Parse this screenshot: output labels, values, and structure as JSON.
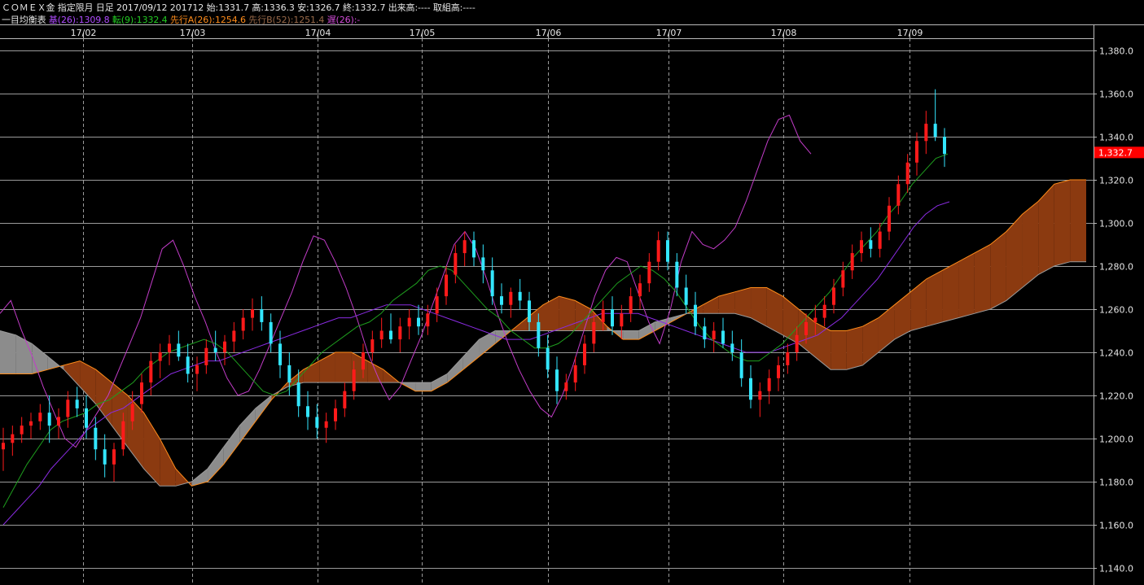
{
  "header": {
    "line1": "ＣＯＭＥＸ金 指定限月 日足 2017/09/12 201712 始:1331.7 高:1336.3 安:1326.7 終:1332.7 出来高:---- 取組高:----",
    "indicator_name": "一目均衡表",
    "base_label": "基(26):1309.8",
    "conv_label": "転(9):1332.4",
    "spanA_label": "先行A(26):1254.6",
    "spanB_label": "先行B(52):1251.4",
    "lag_label": "遅(26):-"
  },
  "colors": {
    "background": "#000000",
    "grid": "#8a8a8a",
    "up_candle": "#ff1a1a",
    "down_candle": "#33e6ff",
    "base_line": "#8a2be2",
    "conversion_line": "#1e9e1e",
    "span_a": "#ff8c1a",
    "span_b": "#9a9a9a",
    "lagging_span": "#c23cc8",
    "cloud_bull": "#8b3a10",
    "cloud_bear": "#8c8c8c",
    "last_price_bg": "#ff0000",
    "base_label_color": "#b04cff",
    "conv_label_color": "#22cc22",
    "spanA_label_color": "#ff8c1a",
    "spanB_label_color": "#9a6a4a",
    "lag_label_color": "#d24cd8"
  },
  "chart_data": {
    "type": "candlestick",
    "x_ticks": [
      "17/02",
      "17/03",
      "17/04",
      "17/05",
      "17/06",
      "17/07",
      "17/08",
      "17/09"
    ],
    "y_ticks": [
      "1,380.0",
      "1,360.0",
      "1,340.0",
      "1,320.0",
      "1,300.0",
      "1,280.0",
      "1,260.0",
      "1,240.0",
      "1,220.0",
      "1,200.0",
      "1,180.0",
      "1,160.0",
      "1,140.0"
    ],
    "ylim": [
      1140,
      1380
    ],
    "last_price": 1332.7,
    "last_price_label": "1,332.7",
    "grid": true,
    "candles": [
      [
        1195,
        1205,
        1185,
        1198
      ],
      [
        1198,
        1206,
        1192,
        1202
      ],
      [
        1202,
        1210,
        1198,
        1206
      ],
      [
        1206,
        1212,
        1200,
        1208
      ],
      [
        1208,
        1216,
        1204,
        1212
      ],
      [
        1212,
        1220,
        1198,
        1206
      ],
      [
        1206,
        1214,
        1200,
        1210
      ],
      [
        1210,
        1222,
        1205,
        1218
      ],
      [
        1218,
        1224,
        1210,
        1214
      ],
      [
        1214,
        1220,
        1200,
        1205
      ],
      [
        1205,
        1210,
        1190,
        1195
      ],
      [
        1195,
        1202,
        1182,
        1188
      ],
      [
        1188,
        1198,
        1180,
        1195
      ],
      [
        1195,
        1212,
        1192,
        1208
      ],
      [
        1208,
        1222,
        1204,
        1216
      ],
      [
        1216,
        1230,
        1212,
        1226
      ],
      [
        1226,
        1240,
        1220,
        1236
      ],
      [
        1236,
        1244,
        1228,
        1240
      ],
      [
        1240,
        1248,
        1234,
        1244
      ],
      [
        1244,
        1250,
        1236,
        1238
      ],
      [
        1238,
        1244,
        1226,
        1230
      ],
      [
        1230,
        1238,
        1222,
        1234
      ],
      [
        1234,
        1246,
        1230,
        1242
      ],
      [
        1242,
        1250,
        1236,
        1240
      ],
      [
        1240,
        1248,
        1234,
        1245
      ],
      [
        1245,
        1254,
        1240,
        1250
      ],
      [
        1250,
        1260,
        1246,
        1256
      ],
      [
        1256,
        1265,
        1250,
        1260
      ],
      [
        1260,
        1266,
        1250,
        1254
      ],
      [
        1254,
        1258,
        1240,
        1244
      ],
      [
        1244,
        1250,
        1228,
        1234
      ],
      [
        1234,
        1240,
        1220,
        1226
      ],
      [
        1226,
        1232,
        1210,
        1215
      ],
      [
        1215,
        1222,
        1204,
        1210
      ],
      [
        1210,
        1216,
        1200,
        1205
      ],
      [
        1205,
        1212,
        1198,
        1208
      ],
      [
        1208,
        1218,
        1204,
        1214
      ],
      [
        1214,
        1226,
        1210,
        1222
      ],
      [
        1222,
        1236,
        1218,
        1232
      ],
      [
        1232,
        1244,
        1228,
        1240
      ],
      [
        1240,
        1250,
        1236,
        1246
      ],
      [
        1246,
        1256,
        1242,
        1250
      ],
      [
        1250,
        1258,
        1244,
        1246
      ],
      [
        1246,
        1256,
        1240,
        1252
      ],
      [
        1252,
        1260,
        1246,
        1256
      ],
      [
        1256,
        1262,
        1248,
        1252
      ],
      [
        1252,
        1262,
        1248,
        1258
      ],
      [
        1258,
        1270,
        1254,
        1266
      ],
      [
        1266,
        1280,
        1262,
        1276
      ],
      [
        1276,
        1290,
        1272,
        1286
      ],
      [
        1286,
        1296,
        1280,
        1292
      ],
      [
        1292,
        1296,
        1280,
        1284
      ],
      [
        1284,
        1290,
        1272,
        1278
      ],
      [
        1278,
        1284,
        1262,
        1266
      ],
      [
        1266,
        1272,
        1258,
        1262
      ],
      [
        1262,
        1270,
        1256,
        1268
      ],
      [
        1268,
        1274,
        1260,
        1264
      ],
      [
        1264,
        1268,
        1250,
        1254
      ],
      [
        1254,
        1258,
        1238,
        1242
      ],
      [
        1242,
        1248,
        1228,
        1232
      ],
      [
        1232,
        1238,
        1216,
        1222
      ],
      [
        1222,
        1230,
        1218,
        1226
      ],
      [
        1226,
        1238,
        1222,
        1234
      ],
      [
        1234,
        1248,
        1230,
        1244
      ],
      [
        1244,
        1258,
        1240,
        1254
      ],
      [
        1254,
        1264,
        1250,
        1260
      ],
      [
        1260,
        1266,
        1248,
        1252
      ],
      [
        1252,
        1262,
        1246,
        1258
      ],
      [
        1258,
        1270,
        1254,
        1266
      ],
      [
        1266,
        1276,
        1260,
        1272
      ],
      [
        1272,
        1286,
        1268,
        1282
      ],
      [
        1282,
        1296,
        1278,
        1292
      ],
      [
        1292,
        1296,
        1278,
        1282
      ],
      [
        1282,
        1286,
        1266,
        1270
      ],
      [
        1270,
        1276,
        1258,
        1262
      ],
      [
        1262,
        1268,
        1248,
        1252
      ],
      [
        1252,
        1256,
        1242,
        1246
      ],
      [
        1246,
        1254,
        1240,
        1250
      ],
      [
        1250,
        1256,
        1242,
        1244
      ],
      [
        1244,
        1250,
        1236,
        1240
      ],
      [
        1240,
        1246,
        1224,
        1228
      ],
      [
        1228,
        1234,
        1214,
        1218
      ],
      [
        1218,
        1226,
        1210,
        1222
      ],
      [
        1222,
        1232,
        1216,
        1228
      ],
      [
        1228,
        1238,
        1222,
        1234
      ],
      [
        1234,
        1244,
        1230,
        1240
      ],
      [
        1240,
        1252,
        1236,
        1248
      ],
      [
        1248,
        1258,
        1244,
        1254
      ],
      [
        1254,
        1262,
        1248,
        1256
      ],
      [
        1256,
        1266,
        1252,
        1262
      ],
      [
        1262,
        1274,
        1258,
        1270
      ],
      [
        1270,
        1282,
        1266,
        1278
      ],
      [
        1278,
        1290,
        1274,
        1286
      ],
      [
        1286,
        1296,
        1282,
        1292
      ],
      [
        1292,
        1298,
        1284,
        1288
      ],
      [
        1288,
        1300,
        1284,
        1296
      ],
      [
        1296,
        1312,
        1292,
        1308
      ],
      [
        1308,
        1322,
        1304,
        1318
      ],
      [
        1318,
        1332,
        1314,
        1328
      ],
      [
        1328,
        1342,
        1322,
        1338
      ],
      [
        1338,
        1352,
        1332,
        1346
      ],
      [
        1346,
        1362,
        1338,
        1340
      ],
      [
        1340,
        1344,
        1326,
        1332
      ]
    ],
    "conversion_line": [
      1168,
      1178,
      1188,
      1196,
      1204,
      1208,
      1210,
      1212,
      1216,
      1218,
      1222,
      1226,
      1232,
      1236,
      1240,
      1242,
      1244,
      1246,
      1244,
      1240,
      1234,
      1228,
      1222,
      1220,
      1222,
      1228,
      1234,
      1240,
      1244,
      1248,
      1252,
      1254,
      1258,
      1264,
      1268,
      1272,
      1278,
      1280,
      1278,
      1272,
      1266,
      1260,
      1256,
      1250,
      1246,
      1242,
      1242,
      1244,
      1248,
      1254,
      1260,
      1266,
      1272,
      1276,
      1280,
      1278,
      1274,
      1268,
      1260,
      1252,
      1246,
      1242,
      1238,
      1236,
      1236,
      1240,
      1244,
      1250,
      1256,
      1262,
      1268,
      1276,
      1284,
      1290,
      1296,
      1304,
      1310,
      1318,
      1324,
      1330,
      1332
    ],
    "base_line": [
      1160,
      1166,
      1172,
      1178,
      1186,
      1192,
      1198,
      1204,
      1208,
      1212,
      1214,
      1218,
      1222,
      1226,
      1230,
      1232,
      1234,
      1236,
      1236,
      1238,
      1240,
      1242,
      1244,
      1246,
      1248,
      1250,
      1252,
      1254,
      1256,
      1256,
      1258,
      1260,
      1262,
      1262,
      1262,
      1260,
      1258,
      1256,
      1254,
      1252,
      1250,
      1248,
      1246,
      1246,
      1246,
      1248,
      1250,
      1252,
      1254,
      1256,
      1258,
      1258,
      1258,
      1258,
      1256,
      1254,
      1252,
      1250,
      1248,
      1246,
      1244,
      1242,
      1240,
      1240,
      1240,
      1242,
      1244,
      1246,
      1248,
      1252,
      1256,
      1262,
      1268,
      1274,
      1282,
      1290,
      1298,
      1304,
      1308,
      1309.8
    ],
    "lagging_span": [
      1258,
      1264,
      1250,
      1238,
      1224,
      1212,
      1200,
      1196,
      1204,
      1212,
      1220,
      1232,
      1244,
      1256,
      1272,
      1288,
      1292,
      1280,
      1266,
      1254,
      1240,
      1228,
      1220,
      1222,
      1232,
      1244,
      1256,
      1268,
      1282,
      1294,
      1292,
      1282,
      1270,
      1256,
      1240,
      1228,
      1218,
      1224,
      1236,
      1248,
      1262,
      1276,
      1290,
      1296,
      1288,
      1274,
      1258,
      1244,
      1232,
      1222,
      1214,
      1210,
      1220,
      1234,
      1250,
      1266,
      1278,
      1284,
      1282,
      1268,
      1254,
      1244,
      1260,
      1282,
      1296,
      1290,
      1288,
      1292,
      1298,
      1310,
      1324,
      1338,
      1348,
      1350,
      1338,
      1332
    ],
    "span_a": [
      1230,
      1230,
      1230,
      1232,
      1234,
      1236,
      1232,
      1226,
      1220,
      1212,
      1200,
      1186,
      1178,
      1180,
      1188,
      1198,
      1208,
      1218,
      1226,
      1232,
      1236,
      1240,
      1240,
      1236,
      1232,
      1226,
      1222,
      1222,
      1226,
      1232,
      1238,
      1244,
      1250,
      1256,
      1262,
      1266,
      1264,
      1260,
      1252,
      1246,
      1246,
      1250,
      1254,
      1258,
      1262,
      1266,
      1268,
      1270,
      1270,
      1266,
      1260,
      1254,
      1250,
      1250,
      1252,
      1256,
      1262,
      1268,
      1274,
      1278,
      1282,
      1286,
      1290,
      1296,
      1304,
      1310,
      1318,
      1320,
      1320
    ],
    "span_b": [
      1250,
      1248,
      1244,
      1238,
      1232,
      1224,
      1216,
      1206,
      1196,
      1186,
      1178,
      1178,
      1180,
      1186,
      1196,
      1206,
      1214,
      1220,
      1224,
      1226,
      1226,
      1226,
      1226,
      1226,
      1226,
      1226,
      1226,
      1226,
      1230,
      1238,
      1246,
      1250,
      1250,
      1250,
      1250,
      1250,
      1250,
      1250,
      1250,
      1250,
      1250,
      1254,
      1256,
      1258,
      1258,
      1258,
      1258,
      1256,
      1252,
      1248,
      1244,
      1238,
      1232,
      1232,
      1234,
      1240,
      1246,
      1250,
      1252,
      1254,
      1256,
      1258,
      1260,
      1264,
      1270,
      1276,
      1280,
      1282,
      1282
    ]
  }
}
